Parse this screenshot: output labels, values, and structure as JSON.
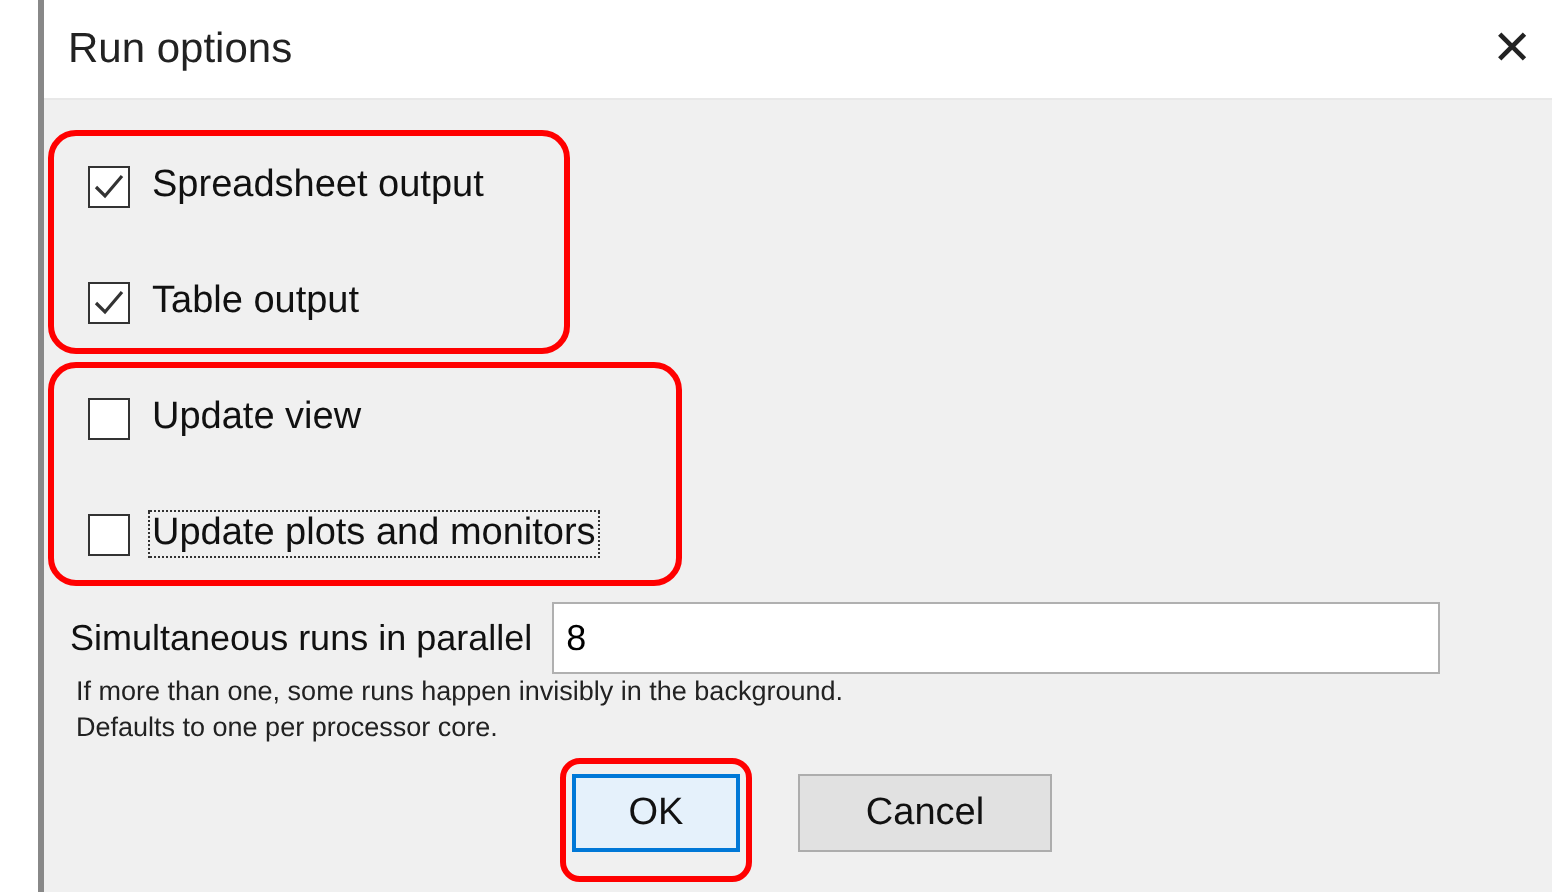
{
  "window": {
    "title": "Run options",
    "close": "✕"
  },
  "option_groups": [
    {
      "highlighted": true,
      "options": [
        {
          "label": "Spreadsheet output",
          "checked": true,
          "focused": false
        },
        {
          "label": "Table output",
          "checked": true,
          "focused": false
        }
      ]
    },
    {
      "highlighted": true,
      "options": [
        {
          "label": "Update view",
          "checked": false,
          "focused": false
        },
        {
          "label": "Update plots and monitors",
          "checked": false,
          "focused": true
        }
      ]
    }
  ],
  "parallel_runs": {
    "label": "Simultaneous runs in parallel",
    "value": "8",
    "hints": [
      "If more than one, some runs happen invisibly in the background.",
      "Defaults to one per processor core."
    ]
  },
  "buttons": [
    {
      "label": "OK",
      "default": true,
      "highlighted": true
    },
    {
      "label": "Cancel",
      "default": false,
      "highlighted": false
    }
  ]
}
